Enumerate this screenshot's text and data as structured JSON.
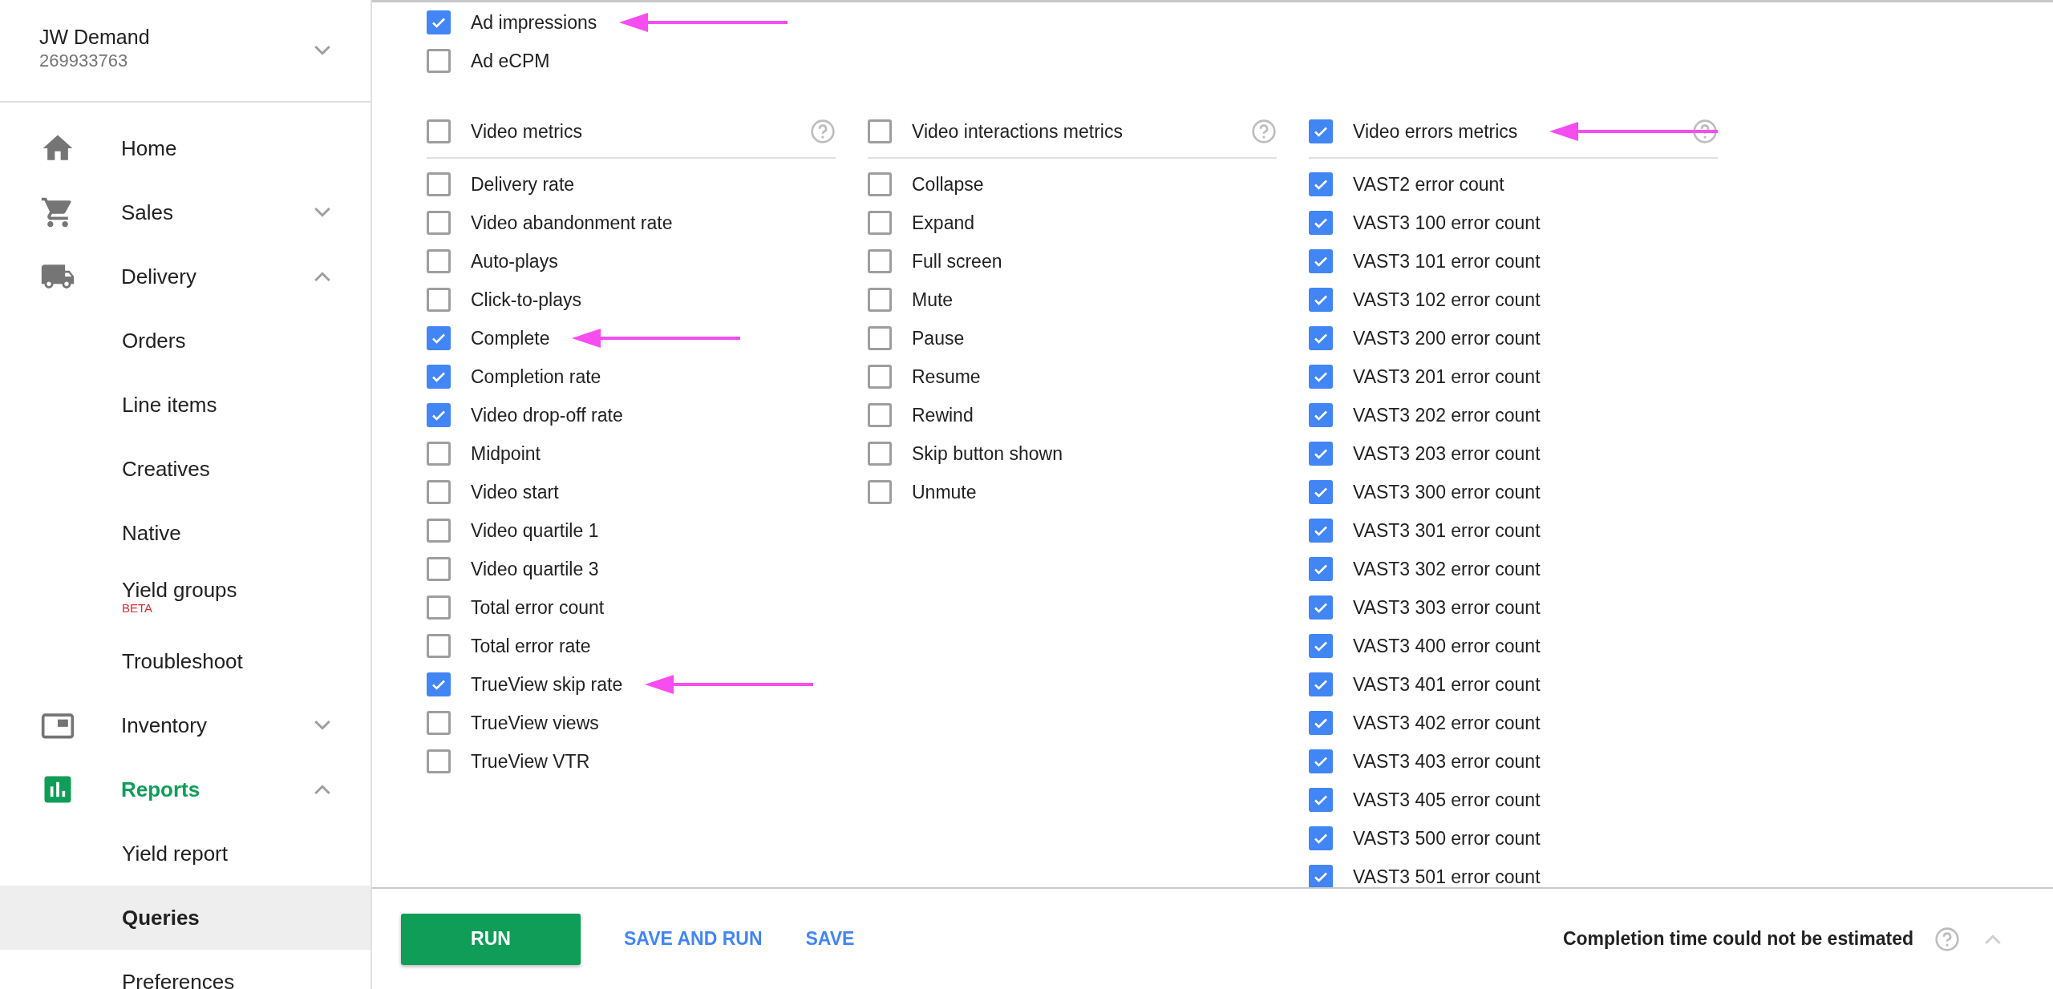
{
  "account": {
    "name": "JW Demand",
    "id": "269933763"
  },
  "nav": [
    {
      "kind": "group",
      "label": "Home",
      "selected": false
    },
    {
      "kind": "group",
      "label": "Sales",
      "selected": false,
      "expandable": true,
      "expanded": false
    },
    {
      "kind": "group",
      "label": "Delivery",
      "selected": false,
      "expandable": true,
      "expanded": true,
      "children": [
        {
          "label": "Orders",
          "selected": false
        },
        {
          "label": "Line items",
          "selected": false
        },
        {
          "label": "Creatives",
          "selected": false
        },
        {
          "label": "Native",
          "selected": false
        },
        {
          "label": "Yield groups",
          "badge": "BETA",
          "selected": false
        },
        {
          "label": "Troubleshoot",
          "selected": false
        }
      ]
    },
    {
      "kind": "group",
      "label": "Inventory",
      "selected": false,
      "expandable": true,
      "expanded": false
    },
    {
      "kind": "group",
      "label": "Reports",
      "selected": true,
      "expandable": true,
      "expanded": true,
      "children": [
        {
          "label": "Yield report",
          "selected": false
        },
        {
          "label": "Queries",
          "selected": true
        },
        {
          "label": "Preferences",
          "selected": false
        }
      ]
    }
  ],
  "top_metrics": [
    {
      "label": "Ad impressions",
      "checked": true,
      "arrow": true
    },
    {
      "label": "Ad eCPM",
      "checked": false,
      "arrow": false
    }
  ],
  "groups": [
    {
      "label": "Video metrics",
      "checked": false,
      "arrow": false,
      "items": [
        {
          "label": "Delivery rate",
          "checked": false,
          "arrow": false
        },
        {
          "label": "Video abandonment rate",
          "checked": false,
          "arrow": false
        },
        {
          "label": "Auto-plays",
          "checked": false,
          "arrow": false
        },
        {
          "label": "Click-to-plays",
          "checked": false,
          "arrow": false
        },
        {
          "label": "Complete",
          "checked": true,
          "arrow": true
        },
        {
          "label": "Completion rate",
          "checked": true,
          "arrow": false
        },
        {
          "label": "Video drop-off rate",
          "checked": true,
          "arrow": false
        },
        {
          "label": "Midpoint",
          "checked": false,
          "arrow": false
        },
        {
          "label": "Video start",
          "checked": false,
          "arrow": false
        },
        {
          "label": "Video quartile 1",
          "checked": false,
          "arrow": false
        },
        {
          "label": "Video quartile 3",
          "checked": false,
          "arrow": false
        },
        {
          "label": "Total error count",
          "checked": false,
          "arrow": false
        },
        {
          "label": "Total error rate",
          "checked": false,
          "arrow": false
        },
        {
          "label": "TrueView skip rate",
          "checked": true,
          "arrow": true
        },
        {
          "label": "TrueView views",
          "checked": false,
          "arrow": false
        },
        {
          "label": "TrueView VTR",
          "checked": false,
          "arrow": false
        }
      ]
    },
    {
      "label": "Video interactions metrics",
      "checked": false,
      "arrow": false,
      "items": [
        {
          "label": "Collapse",
          "checked": false,
          "arrow": false
        },
        {
          "label": "Expand",
          "checked": false,
          "arrow": false
        },
        {
          "label": "Full screen",
          "checked": false,
          "arrow": false
        },
        {
          "label": "Mute",
          "checked": false,
          "arrow": false
        },
        {
          "label": "Pause",
          "checked": false,
          "arrow": false
        },
        {
          "label": "Resume",
          "checked": false,
          "arrow": false
        },
        {
          "label": "Rewind",
          "checked": false,
          "arrow": false
        },
        {
          "label": "Skip button shown",
          "checked": false,
          "arrow": false
        },
        {
          "label": "Unmute",
          "checked": false,
          "arrow": false
        }
      ]
    },
    {
      "label": "Video errors metrics",
      "checked": true,
      "arrow": true,
      "items": [
        {
          "label": "VAST2 error count",
          "checked": true,
          "arrow": false
        },
        {
          "label": "VAST3 100 error count",
          "checked": true,
          "arrow": false
        },
        {
          "label": "VAST3 101 error count",
          "checked": true,
          "arrow": false
        },
        {
          "label": "VAST3 102 error count",
          "checked": true,
          "arrow": false
        },
        {
          "label": "VAST3 200 error count",
          "checked": true,
          "arrow": false
        },
        {
          "label": "VAST3 201 error count",
          "checked": true,
          "arrow": false
        },
        {
          "label": "VAST3 202 error count",
          "checked": true,
          "arrow": false
        },
        {
          "label": "VAST3 203 error count",
          "checked": true,
          "arrow": false
        },
        {
          "label": "VAST3 300 error count",
          "checked": true,
          "arrow": false
        },
        {
          "label": "VAST3 301 error count",
          "checked": true,
          "arrow": false
        },
        {
          "label": "VAST3 302 error count",
          "checked": true,
          "arrow": false
        },
        {
          "label": "VAST3 303 error count",
          "checked": true,
          "arrow": false
        },
        {
          "label": "VAST3 400 error count",
          "checked": true,
          "arrow": false
        },
        {
          "label": "VAST3 401 error count",
          "checked": true,
          "arrow": false
        },
        {
          "label": "VAST3 402 error count",
          "checked": true,
          "arrow": false
        },
        {
          "label": "VAST3 403 error count",
          "checked": true,
          "arrow": false
        },
        {
          "label": "VAST3 405 error count",
          "checked": true,
          "arrow": false
        },
        {
          "label": "VAST3 500 error count",
          "checked": true,
          "arrow": false
        },
        {
          "label": "VAST3 501 error count",
          "checked": true,
          "arrow": false
        }
      ]
    }
  ],
  "footer": {
    "buttons": [
      {
        "label": "RUN",
        "kind": "primary"
      },
      {
        "label": "SAVE AND RUN",
        "kind": "text"
      },
      {
        "label": "SAVE",
        "kind": "text"
      }
    ],
    "status": "Completion time could not be estimated"
  }
}
